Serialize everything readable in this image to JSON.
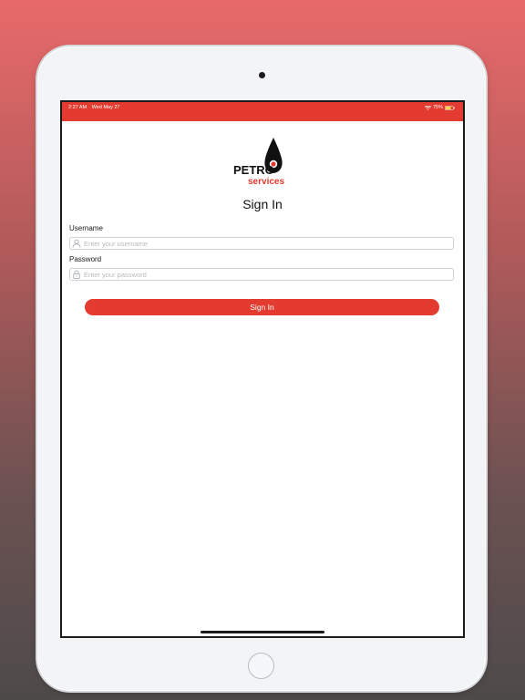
{
  "status_bar": {
    "time": "2:27 AM",
    "date": "Wed May 27",
    "battery_percent": "75%",
    "battery_level": 0.75
  },
  "logo": {
    "word_top": "PETRO",
    "word_bottom": "services"
  },
  "form": {
    "title": "Sign In",
    "username_label": "Username",
    "username_placeholder": "Enter your username",
    "username_value": "",
    "password_label": "Password",
    "password_placeholder": "Enter your password",
    "password_value": "",
    "submit_label": "Sign In"
  },
  "colors": {
    "accent": "#e33b2f",
    "background_top": "#e86a6a",
    "background_bottom": "#4e4a4a"
  },
  "icons": {
    "username_field": "user-icon",
    "password_field": "lock-icon",
    "status_wifi": "wifi-icon",
    "status_battery": "battery-icon"
  }
}
